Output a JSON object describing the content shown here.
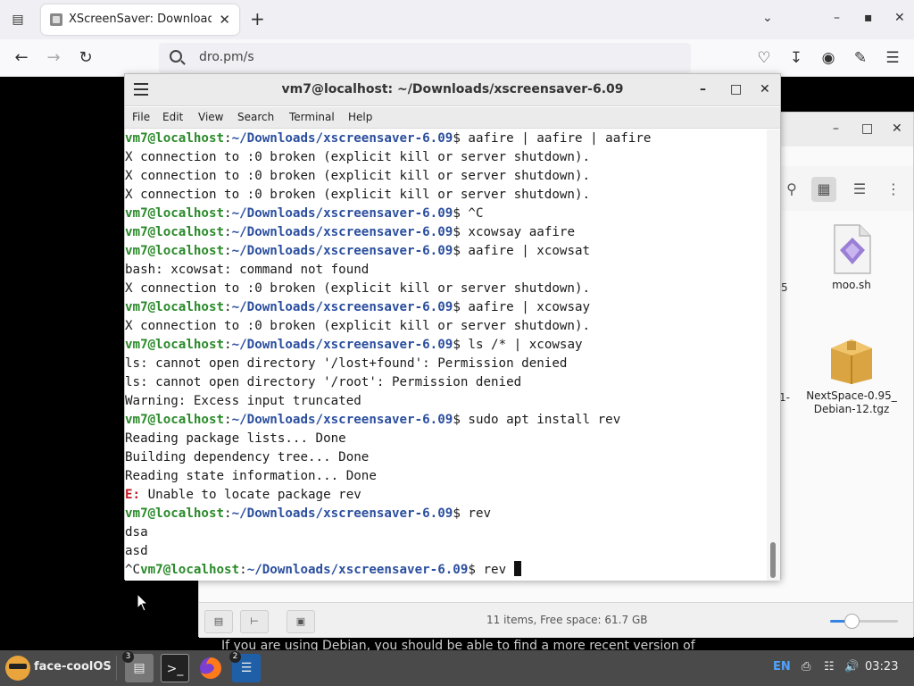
{
  "browser": {
    "tab_title": "XScreenSaver: Download",
    "url": "dro.pm/s",
    "page_text": "If you are using Debian, you should be able to find a more recent version of"
  },
  "terminal": {
    "title": "vm7@localhost: ~/Downloads/xscreensaver-6.09",
    "menu": [
      "File",
      "Edit",
      "View",
      "Search",
      "Terminal",
      "Help"
    ],
    "prompt_user": "vm7@localhost",
    "prompt_sep": ":",
    "prompt_path": "~/Downloads/xscreensaver-6.09",
    "lines": [
      {
        "type": "prompt",
        "cmd": "aafire | aafire | aafire"
      },
      {
        "type": "out",
        "text": "X connection to :0 broken (explicit kill or server shutdown)."
      },
      {
        "type": "out",
        "text": "X connection to :0 broken (explicit kill or server shutdown)."
      },
      {
        "type": "out",
        "text": "X connection to :0 broken (explicit kill or server shutdown)."
      },
      {
        "type": "prompt",
        "cmd": "^C"
      },
      {
        "type": "prompt",
        "cmd": "xcowsay aafire"
      },
      {
        "type": "prompt",
        "cmd": "aafire | xcowsat"
      },
      {
        "type": "out",
        "text": "bash: xcowsat: command not found"
      },
      {
        "type": "out",
        "text": "X connection to :0 broken (explicit kill or server shutdown)."
      },
      {
        "type": "prompt",
        "cmd": "aafire | xcowsay"
      },
      {
        "type": "out",
        "text": "X connection to :0 broken (explicit kill or server shutdown)."
      },
      {
        "type": "prompt",
        "cmd": "ls /* | xcowsay"
      },
      {
        "type": "out",
        "text": "ls: cannot open directory '/lost+found': Permission denied"
      },
      {
        "type": "out",
        "text": "ls: cannot open directory '/root': Permission denied"
      },
      {
        "type": "out",
        "text": "Warning: Excess input truncated"
      },
      {
        "type": "prompt",
        "cmd": "sudo apt install rev"
      },
      {
        "type": "out",
        "text": "Reading package lists... Done"
      },
      {
        "type": "out",
        "text": "Building dependency tree... Done"
      },
      {
        "type": "out",
        "text": "Reading state information... Done"
      },
      {
        "type": "err",
        "label": "E:",
        "text": " Unable to locate package rev"
      },
      {
        "type": "prompt",
        "cmd": "rev"
      },
      {
        "type": "out",
        "text": "dsa"
      },
      {
        "type": "out",
        "text": "asd"
      },
      {
        "type": "prompt",
        "prefix": "^C",
        "cmd": "rev ",
        "cursor": true
      }
    ]
  },
  "file_manager": {
    "items": [
      {
        "name": "moo.sh",
        "icon": "script-file-icon"
      },
      {
        "name": "NextSpace-0.95_\nDebian-12.tgz",
        "icon": "archive-icon"
      }
    ],
    "partial_labels": [
      "5",
      "1-"
    ],
    "status": "11 items, Free space: 61.7 GB",
    "zoom_level": 0.5
  },
  "taskbar": {
    "start_label": "face-coolOS",
    "apps": [
      {
        "name": "files",
        "badge": "3"
      },
      {
        "name": "terminal",
        "badge": ""
      },
      {
        "name": "firefox",
        "badge": ""
      },
      {
        "name": "text-editor",
        "badge": "2"
      }
    ],
    "lang": "EN",
    "time": "03:23"
  }
}
